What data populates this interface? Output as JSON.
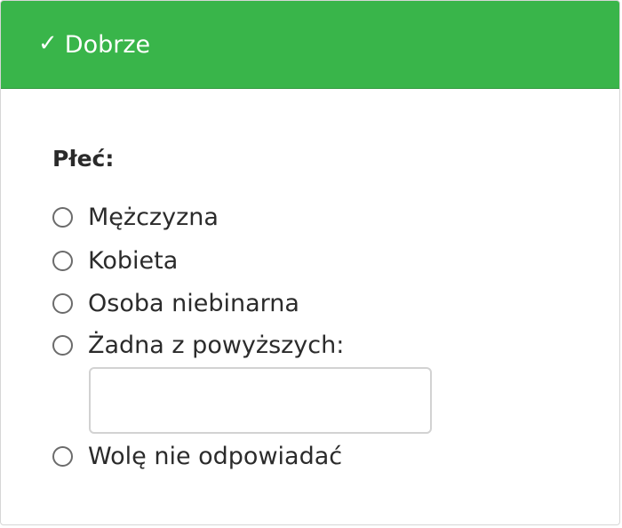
{
  "header": {
    "icon": "check-icon",
    "title": "Dobrze",
    "background_color": "#39b54a",
    "text_color": "#ffffff"
  },
  "question": {
    "label": "Płeć:"
  },
  "options": [
    {
      "label": "Mężczyzna",
      "selected": false
    },
    {
      "label": "Kobieta",
      "selected": false
    },
    {
      "label": "Osoba niebinarna",
      "selected": false
    },
    {
      "label": "Żadna z powyższych:",
      "selected": false
    },
    {
      "label": "Wolę nie odpowiadać",
      "selected": false
    }
  ],
  "other_input": {
    "value": "",
    "placeholder": ""
  }
}
